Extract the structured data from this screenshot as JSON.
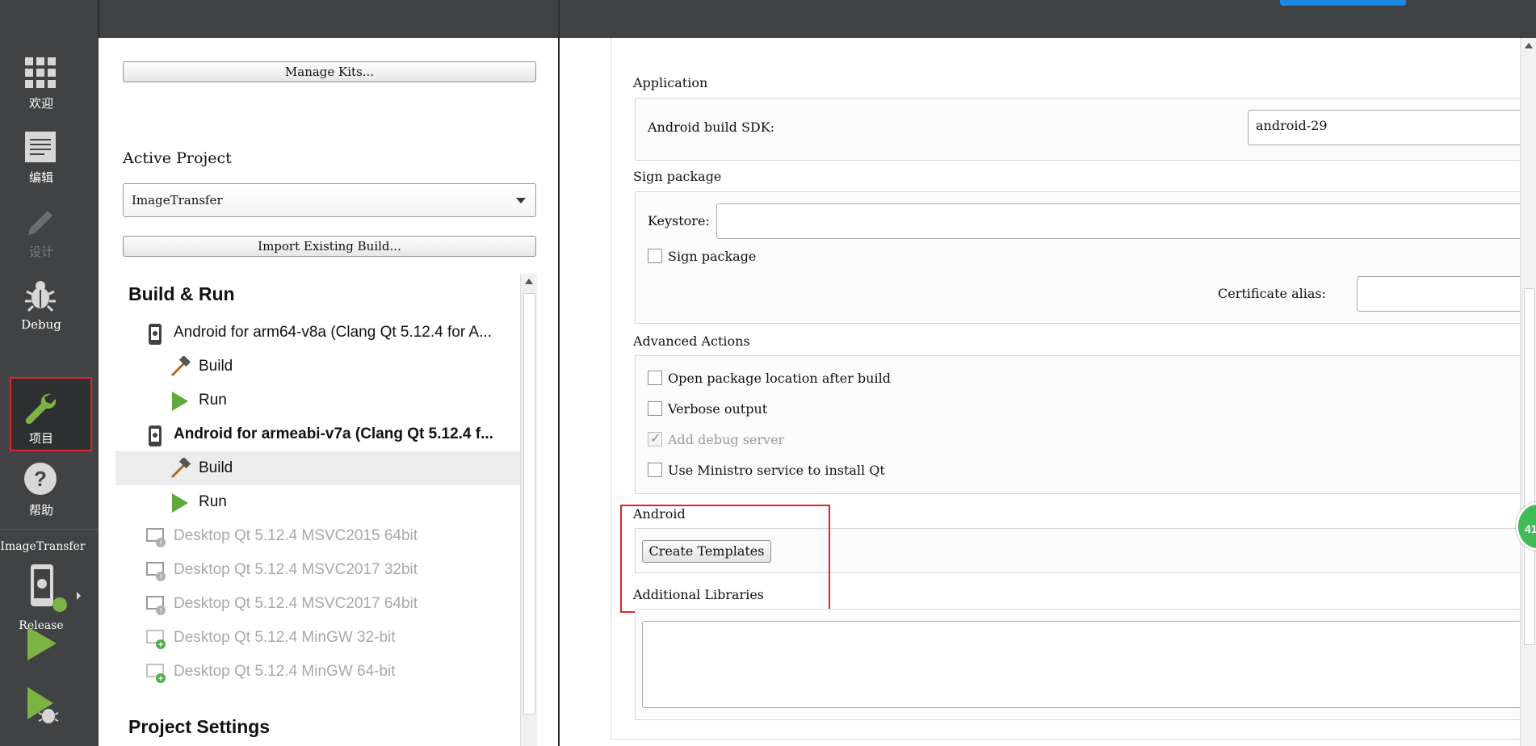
{
  "modebar": {
    "modes": [
      {
        "label": "欢迎",
        "icon": "grid-icon"
      },
      {
        "label": "编辑",
        "icon": "document-icon"
      },
      {
        "label": "设计",
        "icon": "pencil-icon"
      },
      {
        "label": "Debug",
        "icon": "bug-icon"
      },
      {
        "label": "项目",
        "icon": "wrench-icon"
      },
      {
        "label": "帮助",
        "icon": "help-icon"
      }
    ],
    "target": {
      "project": "ImageTransfer",
      "build": "Release"
    },
    "run_icon": "run-icon",
    "debug_run_icon": "debug-run-icon"
  },
  "left": {
    "manage_kits_label": "Manage Kits...",
    "active_project_title": "Active Project",
    "active_project_value": "ImageTransfer",
    "import_build_label": "Import Existing Build...",
    "build_run_title": "Build & Run",
    "kits": [
      {
        "label": "Android for arm64-v8a (Clang Qt 5.12.4 for A...",
        "state": "normal"
      },
      {
        "label": "Build",
        "state": "child"
      },
      {
        "label": "Run",
        "state": "child"
      },
      {
        "label": "Android for armeabi-v7a (Clang Qt 5.12.4 f...",
        "state": "bold"
      },
      {
        "label": "Build",
        "state": "selected"
      },
      {
        "label": "Run",
        "state": "child"
      },
      {
        "label": "Desktop Qt 5.12.4 MSVC2015 64bit",
        "state": "disabled"
      },
      {
        "label": "Desktop Qt 5.12.4 MSVC2017 32bit",
        "state": "disabled"
      },
      {
        "label": "Desktop Qt 5.12.4 MSVC2017 64bit",
        "state": "disabled"
      },
      {
        "label": "Desktop Qt 5.12.4 MinGW 32-bit",
        "state": "disabled"
      },
      {
        "label": "Desktop Qt 5.12.4 MinGW 64-bit",
        "state": "disabled"
      }
    ],
    "project_settings_title": "Project Settings"
  },
  "right": {
    "application_title": "Application",
    "android_build_sdk_label": "Android build SDK:",
    "android_build_sdk_value": "android-29",
    "sign_package_title": "Sign package",
    "keystore_label": "Keystore:",
    "keystore_value": "",
    "sign_package_checkbox": "Sign package",
    "certificate_alias_label": "Certificate alias:",
    "advanced_actions_title": "Advanced Actions",
    "advanced_options": [
      {
        "label": "Open package location after build",
        "checked": false,
        "enabled": true
      },
      {
        "label": "Verbose output",
        "checked": false,
        "enabled": true
      },
      {
        "label": "Add debug server",
        "checked": true,
        "enabled": false
      },
      {
        "label": "Use Ministro service to install Qt",
        "checked": false,
        "enabled": true
      }
    ],
    "android_title": "Android",
    "create_templates_label": "Create Templates",
    "additional_libraries_title": "Additional Libraries",
    "badge_text": "41"
  },
  "colors": {
    "accent_green": "#7cb342",
    "highlight_red": "#e0242a",
    "sidebar_bg": "#404244"
  }
}
